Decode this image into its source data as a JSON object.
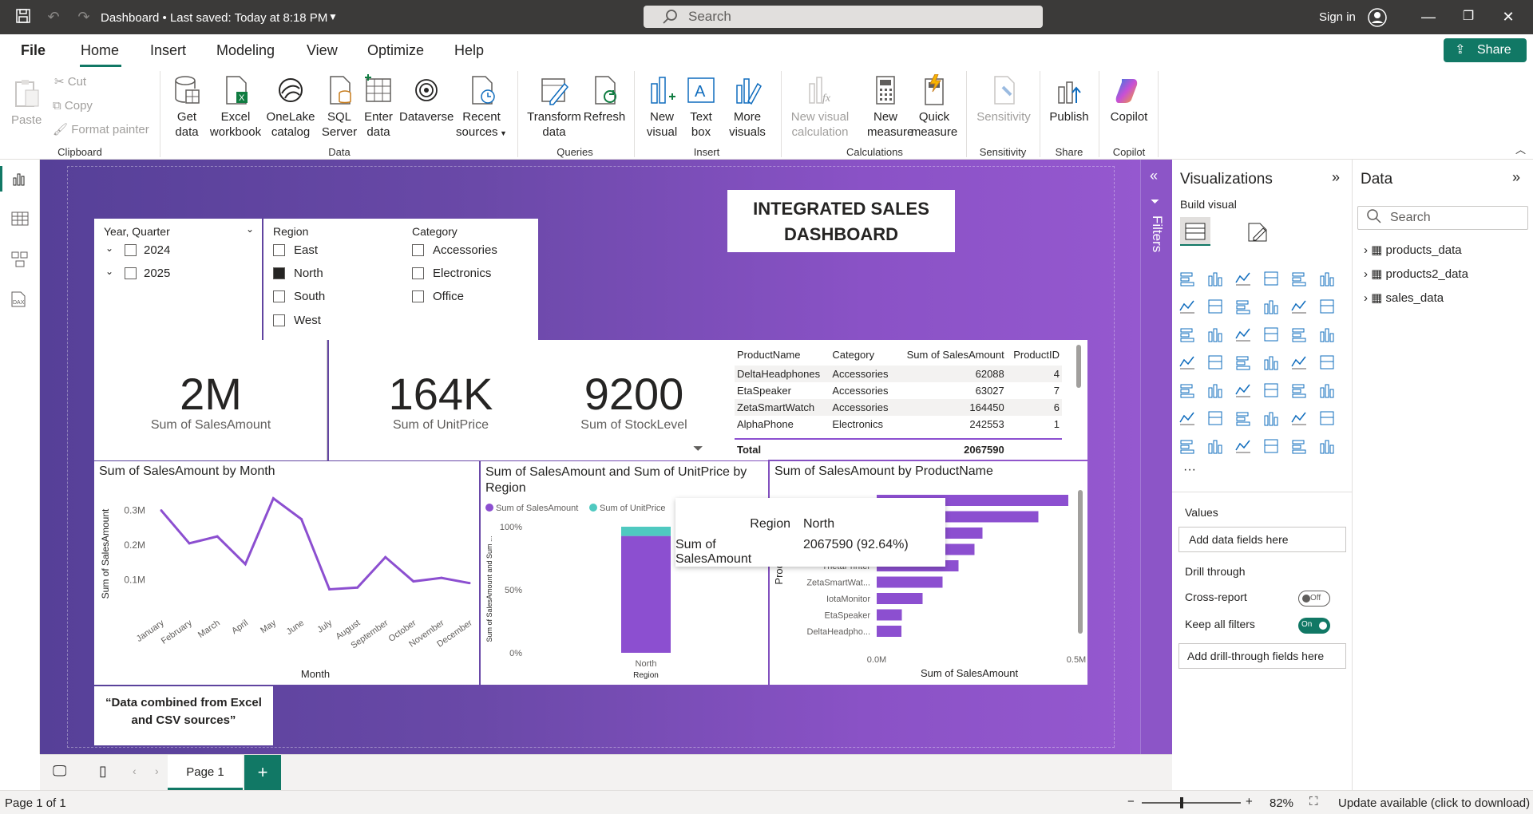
{
  "titlebar": {
    "title": "Dashboard • Last saved: Today at 8:18 PM",
    "search_placeholder": "Search",
    "signin": "Sign in"
  },
  "menu": {
    "items": [
      "File",
      "Home",
      "Insert",
      "Modeling",
      "View",
      "Optimize",
      "Help"
    ],
    "active": "Home",
    "share": "Share"
  },
  "ribbon": {
    "clipboard": {
      "paste": "Paste",
      "cut": "Cut",
      "copy": "Copy",
      "format_painter": "Format painter",
      "group": "Clipboard"
    },
    "data": {
      "get_data": "Get data",
      "excel": "Excel workbook",
      "onelake": "OneLake catalog",
      "sql": "SQL Server",
      "enter": "Enter data",
      "dataverse": "Dataverse",
      "recent": "Recent sources",
      "group": "Data"
    },
    "queries": {
      "transform": "Transform data",
      "refresh": "Refresh",
      "group": "Queries"
    },
    "insert": {
      "new_visual": "New visual",
      "text_box": "Text box",
      "more_visuals": "More visuals",
      "group": "Insert"
    },
    "calculations": {
      "new_visual_calc": "New visual calculation",
      "new_measure": "New measure",
      "quick_measure": "Quick measure",
      "group": "Calculations"
    },
    "sensitivity": {
      "label": "Sensitivity",
      "group": "Sensitivity"
    },
    "share": {
      "publish": "Publish",
      "group": "Share"
    },
    "copilot": {
      "label": "Copilot",
      "group": "Copilot"
    }
  },
  "report": {
    "title": "INTEGRATED SALES DASHBOARD",
    "slicer_year": {
      "header": "Year, Quarter",
      "items": [
        "2024",
        "2025"
      ]
    },
    "slicer_region": {
      "header": "Region",
      "items": [
        "East",
        "North",
        "South",
        "West"
      ],
      "checked": "North"
    },
    "slicer_category": {
      "header": "Category",
      "items": [
        "Accessories",
        "Electronics",
        "Office"
      ]
    },
    "kpis": [
      {
        "value": "2M",
        "label": "Sum of SalesAmount"
      },
      {
        "value": "164K",
        "label": "Sum of UnitPrice"
      },
      {
        "value": "9200",
        "label": "Sum of StockLevel"
      }
    ],
    "table": {
      "headers": [
        "ProductName",
        "Category",
        "Sum of SalesAmount",
        "ProductID"
      ],
      "rows": [
        [
          "DeltaHeadphones",
          "Accessories",
          "62088",
          "4"
        ],
        [
          "EtaSpeaker",
          "Accessories",
          "63027",
          "7"
        ],
        [
          "ZetaSmartWatch",
          "Accessories",
          "164450",
          "6"
        ],
        [
          "AlphaPhone",
          "Electronics",
          "242553",
          "1"
        ]
      ],
      "total_label": "Total",
      "total_value": "2067590"
    },
    "note": "“Data combined from Excel and CSV sources”",
    "tooltip": {
      "k1": "Region",
      "v1": "North",
      "k2": "Sum of SalesAmount",
      "v2": "2067590 (92.64%)"
    }
  },
  "chart_data": [
    {
      "type": "line",
      "title": "Sum of SalesAmount by Month",
      "xlabel": "Month",
      "ylabel": "Sum of SalesAmount",
      "categories": [
        "January",
        "February",
        "March",
        "April",
        "May",
        "June",
        "July",
        "August",
        "September",
        "October",
        "November",
        "December"
      ],
      "values": [
        0.3,
        0.205,
        0.225,
        0.145,
        0.335,
        0.275,
        0.072,
        0.077,
        0.165,
        0.095,
        0.105,
        0.09
      ],
      "yticks": [
        "0.1M",
        "0.2M",
        "0.3M"
      ],
      "color": "#8c4fd0"
    },
    {
      "type": "bar",
      "title": "Sum of SalesAmount and Sum of UnitPrice by Region",
      "xlabel": "Region",
      "ylabel": "Sum of SalesAmount and Sum ...",
      "categories": [
        "North"
      ],
      "series": [
        {
          "name": "Sum of SalesAmount",
          "values": [
            92.64
          ],
          "color": "#8c4fd0"
        },
        {
          "name": "Sum of UnitPrice",
          "values": [
            7.36
          ],
          "color": "#4fc9c0"
        }
      ],
      "yticks": [
        "0%",
        "50%",
        "100%"
      ]
    },
    {
      "type": "bar",
      "title": "Sum of SalesAmount by ProductName",
      "xlabel": "Sum of SalesAmount",
      "ylabel": "Produc",
      "categories": [
        "",
        "",
        "",
        "",
        "ThetaPrinter",
        "ZetaSmartWat...",
        "IotaMonitor",
        "EtaSpeaker",
        "DeltaHeadpho..."
      ],
      "values": [
        0.48,
        0.405,
        0.265,
        0.245,
        0.205,
        0.165,
        0.115,
        0.063,
        0.062
      ],
      "xticks": [
        "0.0M",
        "0.5M"
      ],
      "color": "#8c4fd0"
    }
  ],
  "visualizations": {
    "title": "Visualizations",
    "build": "Build visual",
    "values_label": "Values",
    "values_placeholder": "Add data fields here",
    "drill_through": "Drill through",
    "cross_report": "Cross-report",
    "cross_report_state": "Off",
    "keep_filters": "Keep all filters",
    "keep_filters_state": "On",
    "drill_placeholder": "Add drill-through fields here"
  },
  "filters": {
    "label": "Filters"
  },
  "data_pane": {
    "title": "Data",
    "search_placeholder": "Search",
    "tables": [
      "products_data",
      "products2_data",
      "sales_data"
    ]
  },
  "pages": {
    "current": "Page 1"
  },
  "status": {
    "page": "Page 1 of 1",
    "zoom": "82%",
    "update": "Update available (click to download)"
  }
}
